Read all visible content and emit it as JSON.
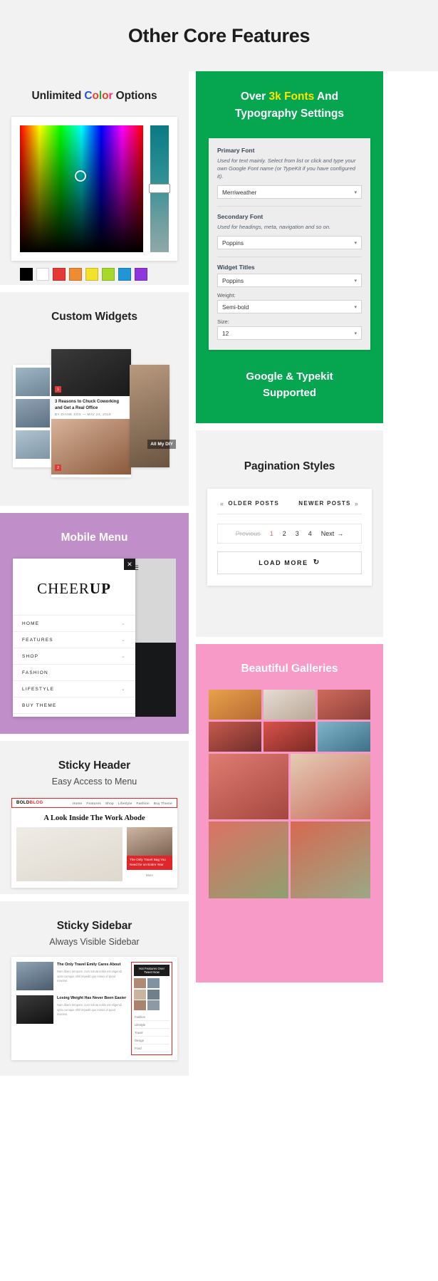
{
  "header": {
    "title": "Other Core Features"
  },
  "colors": {
    "green": "#06a550",
    "purple": "#c08ec8",
    "pink": "#f79ac8",
    "yellow_accent": "#ffe400",
    "red_accent": "#e0262b",
    "page_bg": "#f2f2f2"
  },
  "sections": {
    "color_options": {
      "title_parts": [
        "Unlimited ",
        "C",
        "o",
        "l",
        "o",
        "r",
        " Options"
      ],
      "title_plain": "Unlimited Color Options",
      "picker": {
        "selected_hue_color": "#2d8f93",
        "swatches": [
          "#000000",
          "#ffffff",
          "#e53935",
          "#ef8b33",
          "#f4e12a",
          "#a8d927",
          "#2196d6",
          "#8e35e0"
        ]
      }
    },
    "typography": {
      "title_pre": "Over ",
      "title_highlight": "3k Fonts",
      "title_post": " And",
      "title_line2": "Typography Settings",
      "fields": [
        {
          "label": "Primary Font",
          "desc": "Used for text mainly. Select from list or click and type your own Google Font name (or TypeKit if you have configured it).",
          "value": "Merriweather"
        },
        {
          "label": "Secondary Font",
          "desc": "Used for headings, meta, navigation and so on.",
          "value": "Poppins"
        },
        {
          "label": "Widget Titles",
          "desc": "",
          "value": "Poppins"
        }
      ],
      "weight_label": "Weight:",
      "weight_value": "Semi-bold",
      "size_label": "Size:",
      "size_value": "12",
      "footer_line1": "Google & Typekit",
      "footer_line2": "Supported"
    },
    "custom_widgets": {
      "title": "Custom Widgets",
      "cards": [
        {
          "badge": "1",
          "title": "3 Reasons to Chuck Coworking and Get a Real Office",
          "meta": "BY DIANE SOX — MAY 24, 2018"
        },
        {
          "badge": "2",
          "title": "",
          "meta": ""
        }
      ],
      "overlay_label": "All My DIY"
    },
    "mobile_menu": {
      "title": "Mobile Menu",
      "logo_light": "CHEER",
      "logo_bold": "UP",
      "close_icon": "close-icon",
      "hamburger_icon": "hamburger-icon",
      "items": [
        {
          "label": "HOME",
          "has_caret": true
        },
        {
          "label": "FEATURES",
          "has_caret": true
        },
        {
          "label": "SHOP",
          "has_caret": true
        },
        {
          "label": "FASHION",
          "has_caret": false
        },
        {
          "label": "LIFESTYLE",
          "has_caret": true
        },
        {
          "label": "BUY THEME",
          "has_caret": false
        }
      ]
    },
    "pagination": {
      "title": "Pagination Styles",
      "older_posts": "OLDER POSTS",
      "newer_posts": "NEWER POSTS",
      "prev_chevron": "«",
      "next_chevron": "»",
      "previous_label": "Previous",
      "pages": [
        "1",
        "2",
        "3",
        "4"
      ],
      "current_page": "1",
      "next_label": "Next",
      "next_arrow": "→",
      "load_more": "LOAD MORE",
      "load_more_icon": "refresh-icon"
    },
    "sticky_header": {
      "title": "Sticky Header",
      "subtitle": "Easy Access to Menu",
      "mock": {
        "logo_bold": "BOLD",
        "logo_red": "BLOG",
        "nav": [
          "Home",
          "Features",
          "Shop",
          "Lifestyle",
          "Fashion",
          "Buy Theme"
        ],
        "hero_title": "A Look Inside The Work Abode",
        "side_title": "The Only Travel Bag You Need for an Entire Year",
        "side_more": "More"
      }
    },
    "sticky_sidebar": {
      "title": "Sticky Sidebar",
      "subtitle": "Always Visible Sidebar",
      "mock": {
        "posts": [
          {
            "title": "The Only Travel Emily Cares About",
            "text": "Nam libero tempore, cum soluta nobis est eligendi optio cumque nihil impedit quo minus id quod maxime."
          },
          {
            "title": "Losing Weight Has Never Been Easier",
            "text": "Nam libero tempore, cum soluta nobis est eligendi optio cumque nihil impedit quo minus id quod maxime."
          }
        ],
        "widget_title": "Hot Features Over Tweet Now",
        "list": [
          "Fashion",
          "Lifestyle",
          "Travel",
          "Design",
          "Food"
        ]
      }
    },
    "galleries": {
      "title": "Beautiful Galleries"
    }
  }
}
